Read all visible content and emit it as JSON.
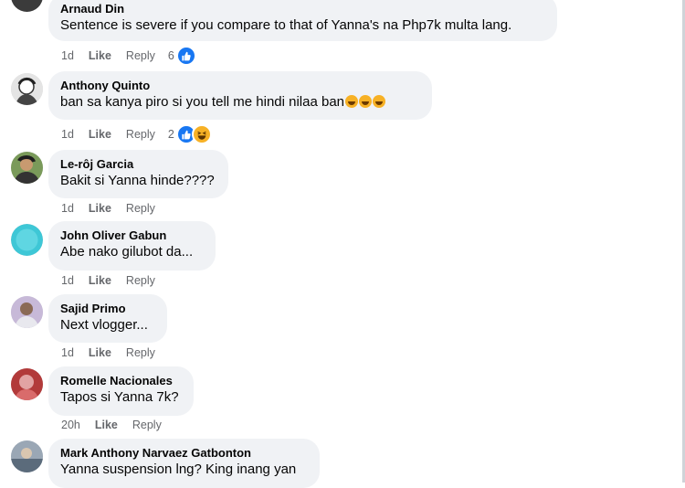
{
  "colors": {
    "bubble_bg": "#f0f2f5",
    "meta_text": "#65676b",
    "like_blue": "#1877f2",
    "haha_yellow": "#f7b125"
  },
  "comments": [
    {
      "author": "Arnaud Din",
      "text": "Sentence is severe if you compare to that of Yanna's na Php7k multa lang.",
      "time": "1d",
      "like": "Like",
      "reply": "Reply",
      "reaction_count": "6",
      "reactions": [
        "like-icon"
      ]
    },
    {
      "author": "Anthony Quinto",
      "text": "ban sa kanya piro si you tell me hindi nilaa ban",
      "text_emojis": [
        "rolling-laughing-emoji",
        "rolling-laughing-emoji",
        "rolling-laughing-emoji"
      ],
      "time": "1d",
      "like": "Like",
      "reply": "Reply",
      "reaction_count": "2",
      "reactions": [
        "like-icon",
        "haha-icon"
      ]
    },
    {
      "author": "Le-rôj Garcia",
      "text": "Bakit si Yanna hinde????",
      "time": "1d",
      "like": "Like",
      "reply": "Reply"
    },
    {
      "author": "John Oliver Gabun",
      "text": "Abe nako gilubot da...",
      "time": "1d",
      "like": "Like",
      "reply": "Reply"
    },
    {
      "author": "Sajid Primo",
      "text": "Next vlogger...",
      "time": "1d",
      "like": "Like",
      "reply": "Reply"
    },
    {
      "author": "Romelle Nacionales",
      "text": "Tapos si Yanna 7k?",
      "time": "20h",
      "like": "Like",
      "reply": "Reply"
    },
    {
      "author": "Mark Anthony Narvaez Gatbonton",
      "text": "Yanna suspension lng? King inang yan",
      "time": "",
      "like": "",
      "reply": ""
    }
  ]
}
